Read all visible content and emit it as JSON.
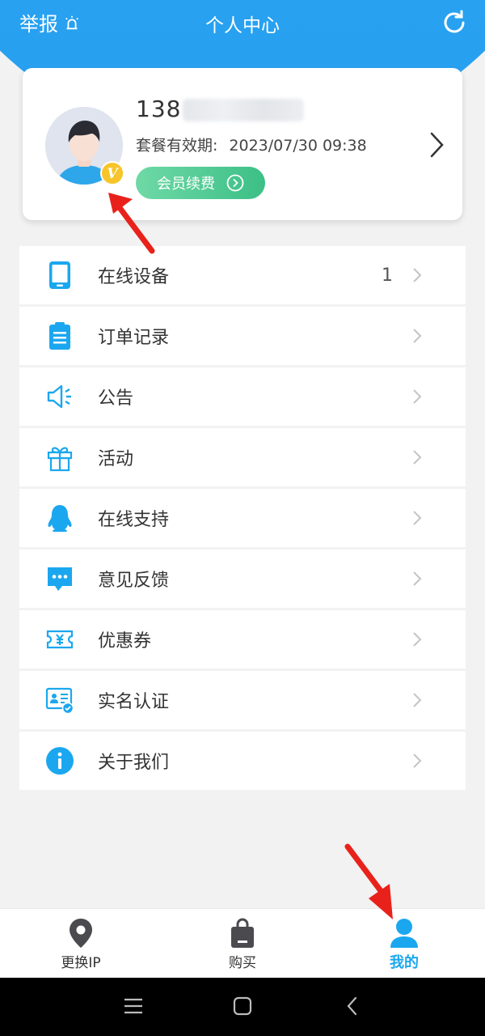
{
  "header": {
    "report_label": "举报",
    "title": "个人中心",
    "report_icon": "alarm-icon",
    "refresh_icon": "refresh-icon",
    "background_color": "#19a6f5"
  },
  "profile": {
    "phone_visible": "138",
    "expiry_label": "套餐有效期:",
    "expiry_value": "2023/07/30 09:38",
    "renew_label": "会员续费",
    "vip_badge": "V",
    "renew_color": "#3cbf86"
  },
  "menu": [
    {
      "label": "在线设备",
      "icon": "tablet-icon",
      "count": "1"
    },
    {
      "label": "订单记录",
      "icon": "clipboard-icon",
      "count": ""
    },
    {
      "label": "公告",
      "icon": "speaker-icon",
      "count": ""
    },
    {
      "label": "活动",
      "icon": "gift-icon",
      "count": ""
    },
    {
      "label": "在线支持",
      "icon": "qq-penguin-icon",
      "count": ""
    },
    {
      "label": "意见反馈",
      "icon": "chat-bubble-icon",
      "count": ""
    },
    {
      "label": "优惠券",
      "icon": "coupon-icon",
      "count": ""
    },
    {
      "label": "实名认证",
      "icon": "id-card-icon",
      "count": ""
    },
    {
      "label": "关于我们",
      "icon": "info-icon",
      "count": ""
    }
  ],
  "tabbar": {
    "tabs": [
      {
        "label": "更换IP",
        "icon": "location-pin-icon",
        "active": false
      },
      {
        "label": "购买",
        "icon": "shopping-bag-icon",
        "active": false
      },
      {
        "label": "我的",
        "icon": "user-icon",
        "active": true
      }
    ],
    "active_color": "#1ba7ef"
  },
  "annotations": {
    "arrow_color": "#e8221b"
  }
}
